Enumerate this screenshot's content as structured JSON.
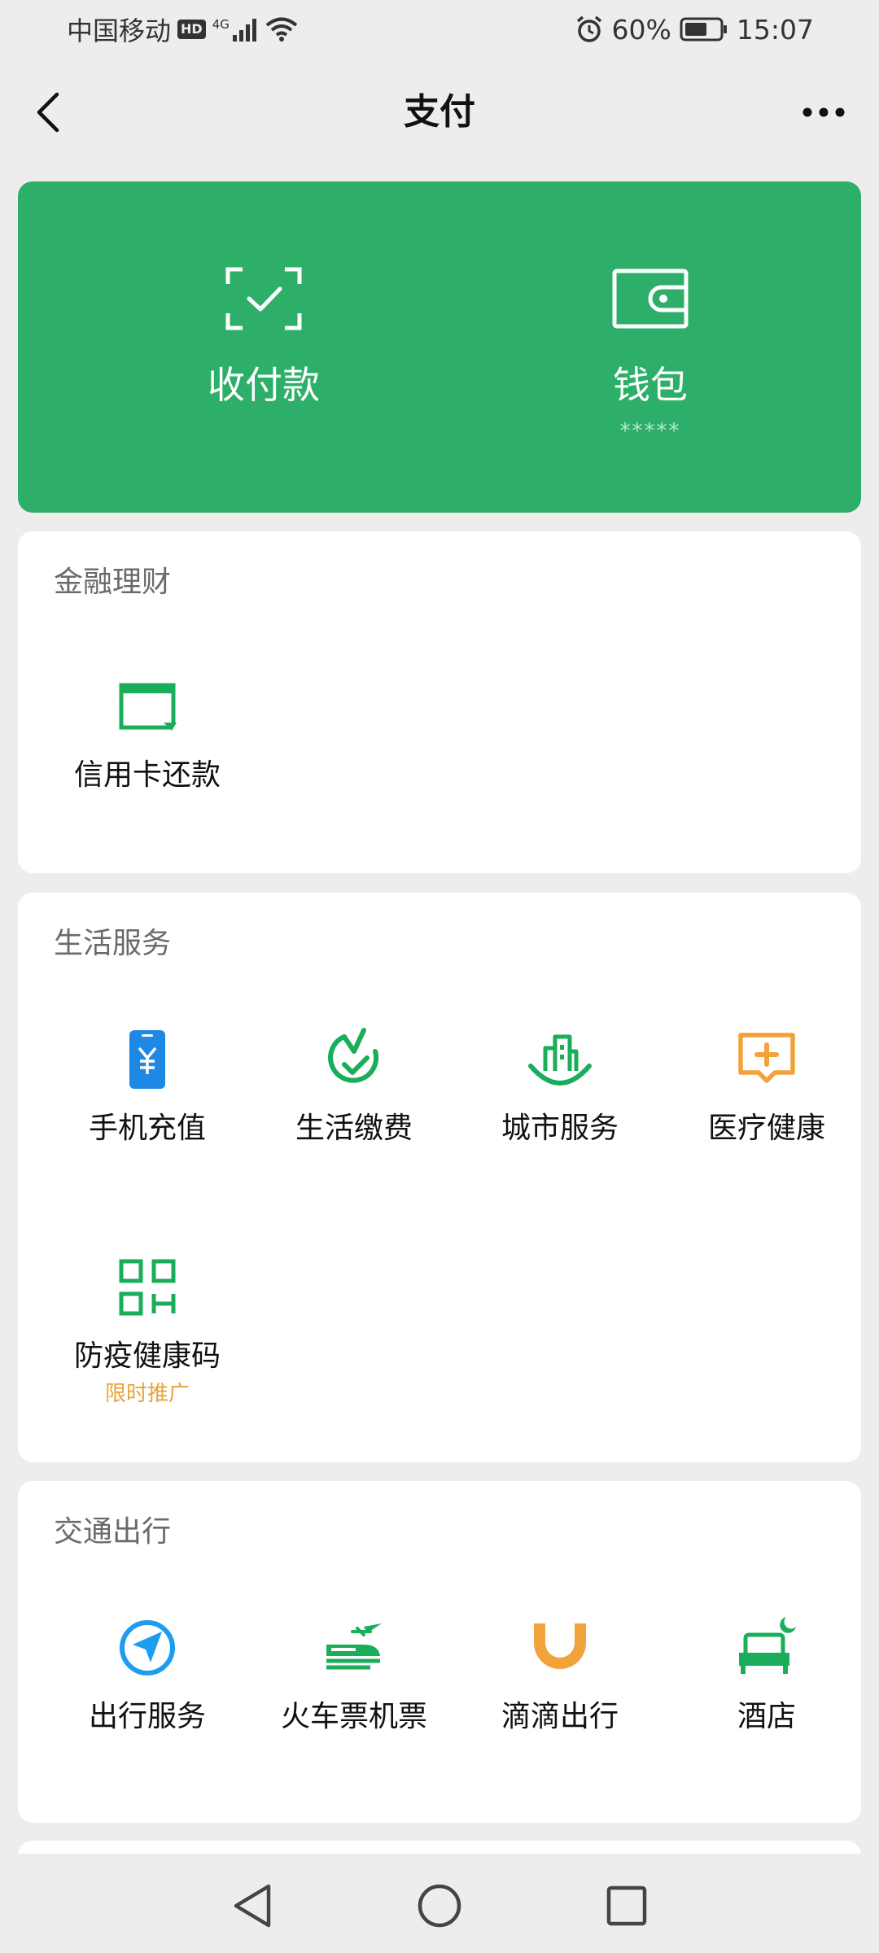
{
  "status_bar": {
    "carrier": "中国移动",
    "hd": "HD",
    "network": "4G",
    "battery": "60%",
    "time": "15:07"
  },
  "nav": {
    "title": "支付"
  },
  "hero": {
    "pay": {
      "label": "收付款",
      "icon": "scan-check-icon"
    },
    "wallet": {
      "label": "钱包",
      "sub": "*****",
      "icon": "wallet-icon"
    }
  },
  "finance": {
    "title": "金融理财",
    "items": [
      {
        "label": "信用卡还款",
        "icon": "credit-card-icon"
      }
    ]
  },
  "life": {
    "title": "生活服务",
    "items": [
      {
        "label": "手机充值",
        "icon": "phone-topup-icon"
      },
      {
        "label": "生活缴费",
        "icon": "bill-pay-icon"
      },
      {
        "label": "城市服务",
        "icon": "city-service-icon"
      },
      {
        "label": "医疗健康",
        "icon": "medical-icon"
      },
      {
        "label": "防疫健康码",
        "icon": "health-code-icon",
        "tag": "限时推广"
      }
    ]
  },
  "transport": {
    "title": "交通出行",
    "items": [
      {
        "label": "出行服务",
        "icon": "navigation-icon"
      },
      {
        "label": "火车票机票",
        "icon": "train-plane-icon"
      },
      {
        "label": "滴滴出行",
        "icon": "didi-icon"
      },
      {
        "label": "酒店",
        "icon": "hotel-icon"
      }
    ]
  },
  "colors": {
    "brand_green": "#2daf69",
    "icon_green": "#1aad5a",
    "blue": "#1e88e5",
    "orange": "#f2a23b",
    "background": "#ededed"
  }
}
